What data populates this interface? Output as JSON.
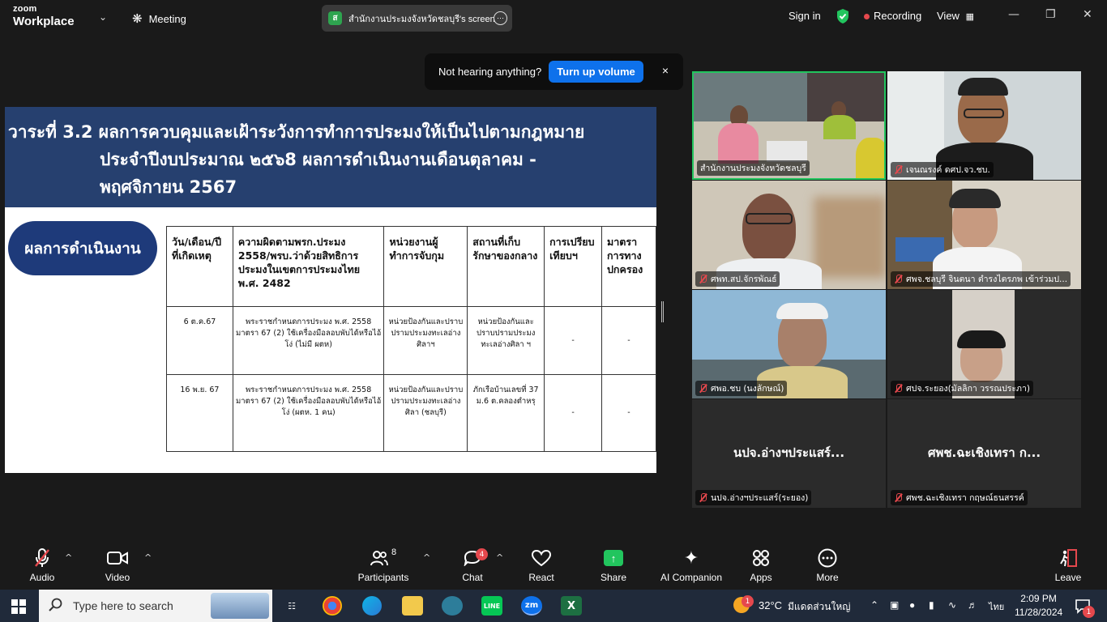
{
  "app": {
    "logo_line1": "zoom",
    "logo_line2": "Workplace",
    "meeting_label": "Meeting",
    "screen_badge": "ส",
    "screen_label": "สำนักงานประมงจังหวัดชลบุรี's screen",
    "sign_in": "Sign in",
    "recording": "Recording",
    "view": "View",
    "accent_color": "#0e71eb"
  },
  "notification": {
    "text": "Not hearing anything?",
    "button": "Turn up volume",
    "close": "×"
  },
  "slide": {
    "title_line1": "วาระที่ 3.2 ผลการควบคุมและเฝ้าระวังการทำการประมงให้เป็นไปตามกฎหมาย",
    "title_line2": "ประจำปีงบประมาณ ๒๕๖8 ผลการดำเนินงานเดือนตุลาคม -",
    "title_line3": "พฤศจิกายน 2567",
    "result_label": "ผลการดำเนินงาน",
    "table": {
      "headers": [
        "วัน/เดือน/ปีที่เกิดเหตุ",
        "ความผิดตามพรก.ประมง 2558/พรบ.ว่าด้วยสิทธิการประมงในเขตการประมงไทย พ.ศ. 2482",
        "หน่วยงานผู้ทำการจับกุม",
        "สถานที่เก็บรักษาของกลาง",
        "การเปรียบเทียบฯ",
        "มาตราการทางปกครอง"
      ],
      "rows": [
        [
          "6 ต.ค.67",
          "พระราชกำหนดการประมง พ.ศ. 2558 มาตรา 67 (2) ใช้เครื่องมือลอบพับได้หรือไอ้โง่ (ไม่มี ผตห)",
          "หน่วยป้องกันและปราบปรามประมงทะเลอ่างศิลาฯ",
          "หน่วยป้องกันและปราบปรามประมงทะเลอ่างศิลา ฯ",
          "-",
          "-"
        ],
        [
          "16 พ.ย. 67",
          "พระราชกำหนดการประมง พ.ศ. 2558 มาตรา 67 (2) ใช้เครื่องมือลอบพับได้หรือไอ้โง่ (ผตห. 1 คน)",
          "หน่วยป้องกันและปราบปรามประมงทะเลอ่างศิลา (ชลบุรี)",
          "ภักเรือบ้านเลขที่ 37 ม.6 ต.คลองตำหรุ",
          "-",
          "-"
        ]
      ]
    }
  },
  "gallery": [
    {
      "name": "สำนักงานประมงจังหวัดชลบุรี",
      "muted": false,
      "active": true
    },
    {
      "name": "เจนณรงค์ ดศป.จว.ชบ.",
      "muted": true
    },
    {
      "name": "ศพท.สป.จักรพัณธ์",
      "muted": true
    },
    {
      "name": "ศพจ.ชลบุรี จินตนา ตำรงไตรภพ เข้าร่วมป...",
      "muted": true
    },
    {
      "name": "ศพอ.ชบ (นงลักษณ์)",
      "muted": true
    },
    {
      "name": "ศปจ.ระยอง(มัลลิกา วรรณประภา)",
      "muted": true
    },
    {
      "name": "นปจ.อ่างฯประแสร์(ระยอง)",
      "display": "นปจ.อ่างฯประแสร์...",
      "muted": true
    },
    {
      "name": "ศพช.ฉะเชิงเทรา กฤษณ์ธนสรรค์",
      "display": "ศพช.ฉะเชิงเทรา ก...",
      "muted": true
    }
  ],
  "toolbar": {
    "audio": "Audio",
    "video": "Video",
    "participants": "Participants",
    "participants_count": "8",
    "chat": "Chat",
    "chat_badge": "4",
    "react": "React",
    "share": "Share",
    "ai_companion": "AI Companion",
    "apps": "Apps",
    "more": "More",
    "leave": "Leave"
  },
  "taskbar": {
    "search_placeholder": "Type here to search",
    "weather_temp": "32°C",
    "weather_text": "มีแดดส่วนใหญ่",
    "weather_badge": "1",
    "lang": "ไทย",
    "time": "2:09 PM",
    "date": "11/28/2024",
    "notif_count": "1"
  }
}
